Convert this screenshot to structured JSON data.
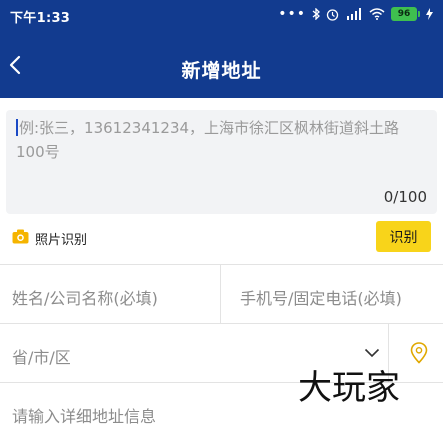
{
  "status_bar": {
    "time": "下午1:33",
    "battery": "96",
    "icons": [
      "more-dots-icon",
      "bluetooth-icon",
      "alarm-icon",
      "signal-icon",
      "wifi-icon",
      "battery-icon",
      "charging-icon"
    ]
  },
  "header": {
    "title": "新增地址",
    "background_color": "#123b8f"
  },
  "smart_input": {
    "placeholder": "例:张三，13612341234，上海市徐汇区枫林街道斜土路100号",
    "counter": "0/100"
  },
  "photo": {
    "label": "照片识别",
    "button_label": "识别",
    "accent_color": "#f8d41a"
  },
  "form": {
    "name_placeholder": "姓名/公司名称(必填)",
    "phone_placeholder": "手机号/固定电话(必填)",
    "region_placeholder": "省/市/区",
    "detail_placeholder": "请输入详细地址信息"
  },
  "watermark": "大玩家"
}
